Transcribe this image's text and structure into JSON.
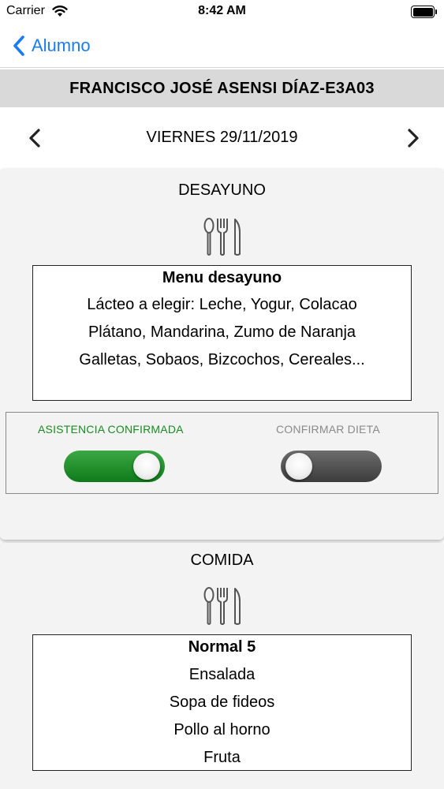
{
  "status_bar": {
    "carrier": "Carrier",
    "time": "8:42 AM"
  },
  "nav": {
    "back_label": "Alumno"
  },
  "student": {
    "header": "FRANCISCO JOSÉ ASENSI DÍAZ-E3A03"
  },
  "date": {
    "label": "VIERNES 29/11/2019"
  },
  "breakfast": {
    "title": "DESAYUNO",
    "menu_title": "Menu desayuno",
    "lines": [
      "Lácteo a elegir: Leche, Yogur, Colacao",
      "Plátano, Mandarina, Zumo de Naranja",
      "Galletas, Sobaos, Bizcochos, Cereales..."
    ],
    "attendance": {
      "label": "ASISTENCIA CONFIRMADA",
      "state": "on"
    },
    "diet": {
      "label": "CONFIRMAR DIETA",
      "state": "off"
    }
  },
  "lunch": {
    "title": "COMIDA",
    "menu_title": "Normal 5",
    "lines": [
      "Ensalada",
      "Sopa de fideos",
      "Pollo al horno",
      "Fruta"
    ]
  },
  "colors": {
    "accent": "#1a7cf4",
    "header_bg": "#d9d9d9",
    "toggle_on": "#1a8a22",
    "toggle_off": "#4a4a4a",
    "card_bg": "#f3f3f3"
  },
  "icons": {
    "back": "chevron-left-icon",
    "prev": "chevron-left-icon",
    "next": "chevron-right-icon",
    "meal": "cutlery-icon",
    "wifi": "wifi-icon",
    "battery": "battery-icon"
  }
}
